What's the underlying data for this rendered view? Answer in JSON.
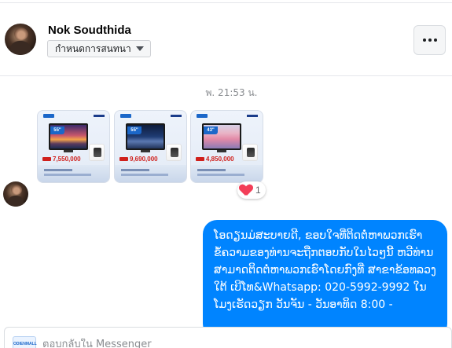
{
  "header": {
    "contact_name": "Nok Soudthida",
    "convo_button_label": "กำหนดการสนทนา",
    "more_label": "..."
  },
  "thread": {
    "timestamp": "พ. 21:53 น.",
    "photos": [
      {
        "size": "55\"",
        "price": "7,550,000",
        "screen": "sunset"
      },
      {
        "size": "55\"",
        "price": "9,690,000",
        "screen": "city"
      },
      {
        "size": "43\"",
        "price": "4,850,000",
        "screen": "pink"
      }
    ],
    "reaction": {
      "emoji": "heart",
      "count": "1"
    },
    "outgoing_message": "ໂອດຽນມ່ສະບາຍດີ, ຂອບໃຈທີ່ຕິດຕໍ່ຫາພວກເຮົາ ຂໍ້ຄວາມຂອງທ່ານຈະຖືກຕອບກັບໃນໄວໆນີ້ ຫວີທ່ານສາມາດຕິດຕໍ່ຫາພວກເຮົາໂດຍກົງທີ່ ສາຂາຂ້ອທລວງໃຕ້ ເບີໂທ&Whatsapp: 020-5992-9992 ໃນໂມງເຮັດວຽກ ວັນຈັນ - ວັນອາທິດ 8:00 -"
  },
  "reply": {
    "placeholder": "ตอบกลับใน Messenger",
    "logo_text": "ODIENMALL"
  },
  "colors": {
    "bubble": "#0084ff",
    "reaction_heart": "#f33e58",
    "price": "#d0201c"
  }
}
